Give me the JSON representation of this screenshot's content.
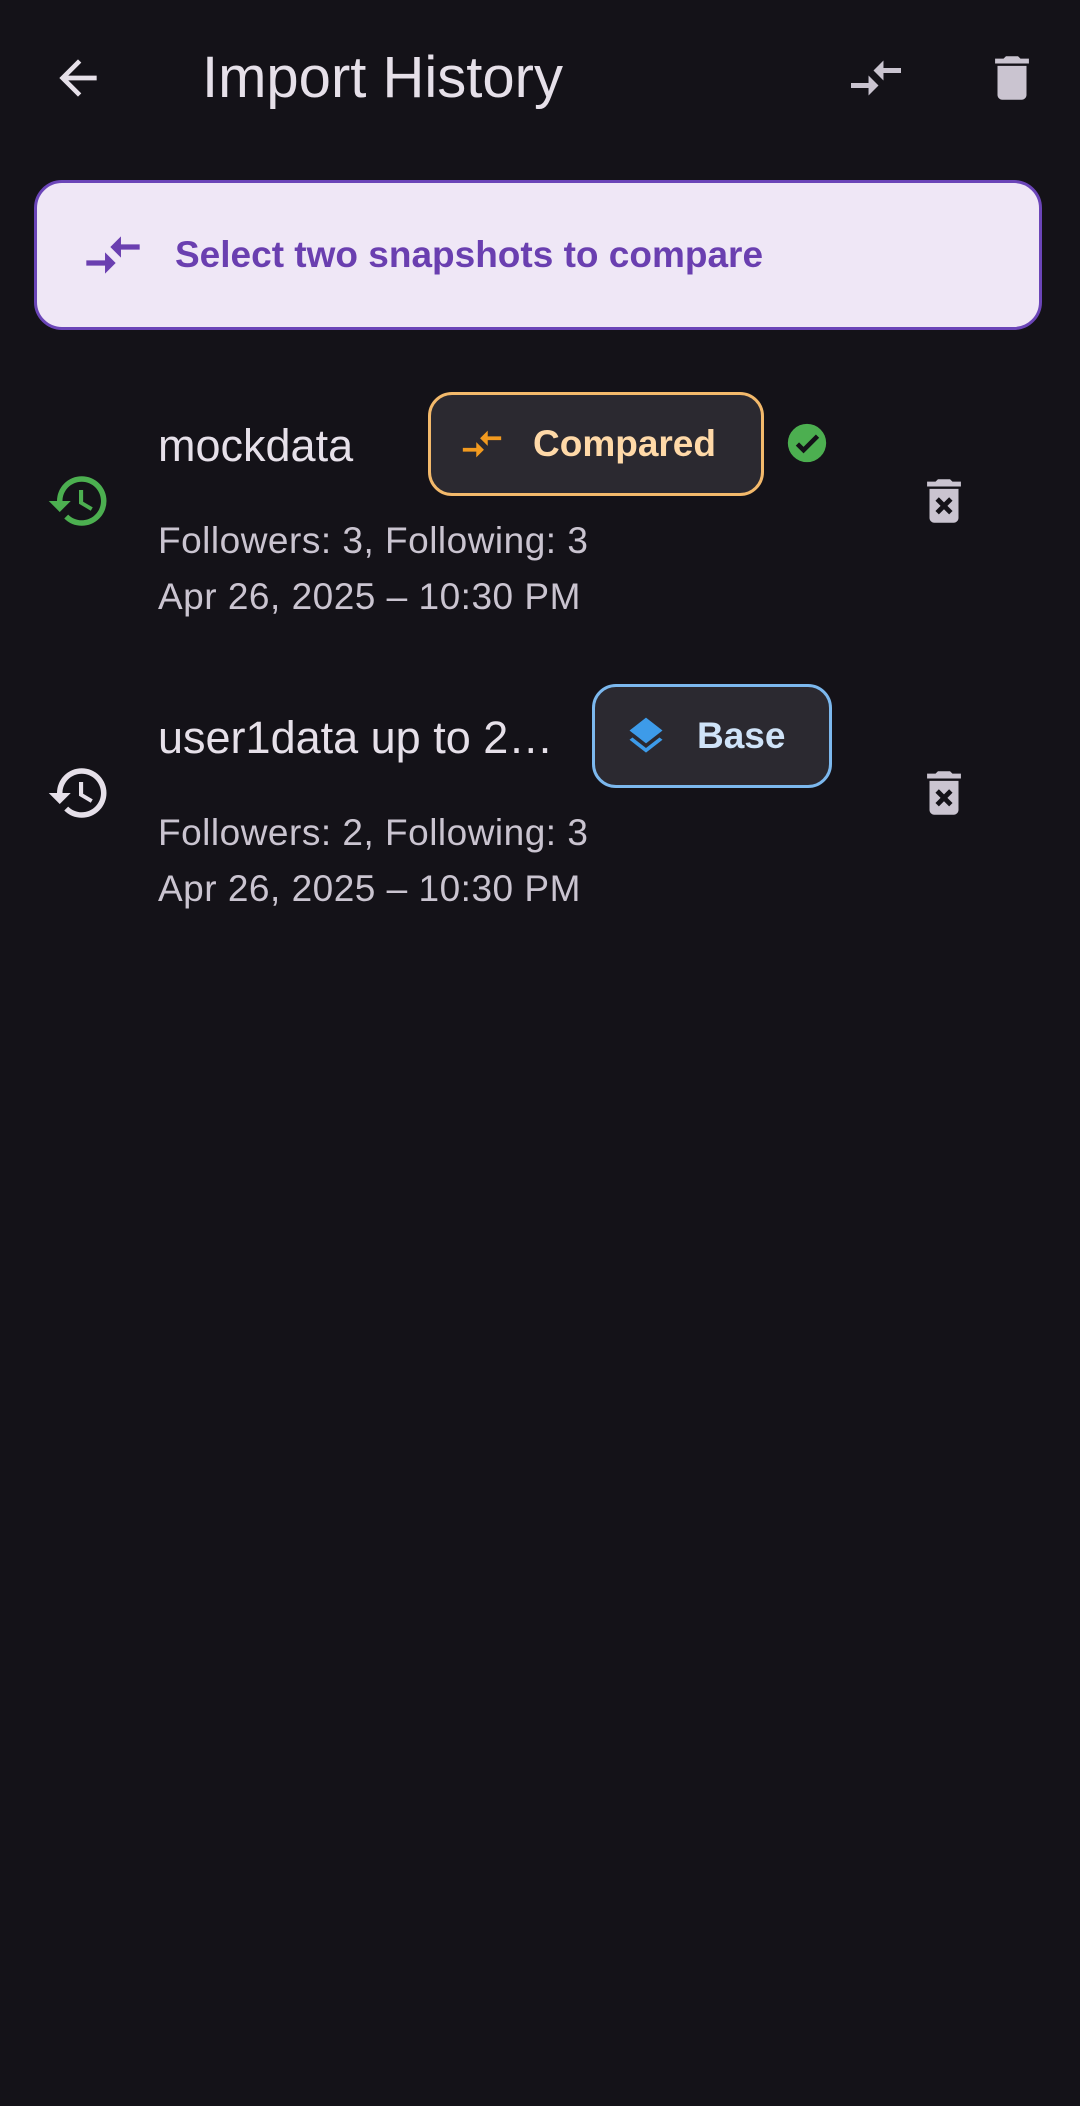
{
  "appbar": {
    "title": "Import History",
    "back_icon": "arrow-back-icon",
    "compare_icon": "compare-arrows-icon",
    "delete_icon": "trash-icon"
  },
  "banner": {
    "text": "Select two snapshots to compare",
    "icon": "compare-arrows-icon",
    "color": "#6a3fb0"
  },
  "snapshots": [
    {
      "name": "mockdata",
      "badge": "Compared",
      "badge_icon": "compare-arrows-icon",
      "badge_color": "#f3b96b",
      "selected": true,
      "counts": "Followers: 3, Following: 3",
      "date": "Apr 26, 2025 – 10:30 PM",
      "history_icon_color": "#4caf50"
    },
    {
      "name": "user1data up to 2…",
      "badge": "Base",
      "badge_icon": "layers-icon",
      "badge_color": "#7cb8ee",
      "selected": false,
      "counts": "Followers: 2, Following: 3",
      "date": "Apr 26, 2025 – 10:30 PM",
      "history_icon_color": "#e6e0e9"
    }
  ]
}
